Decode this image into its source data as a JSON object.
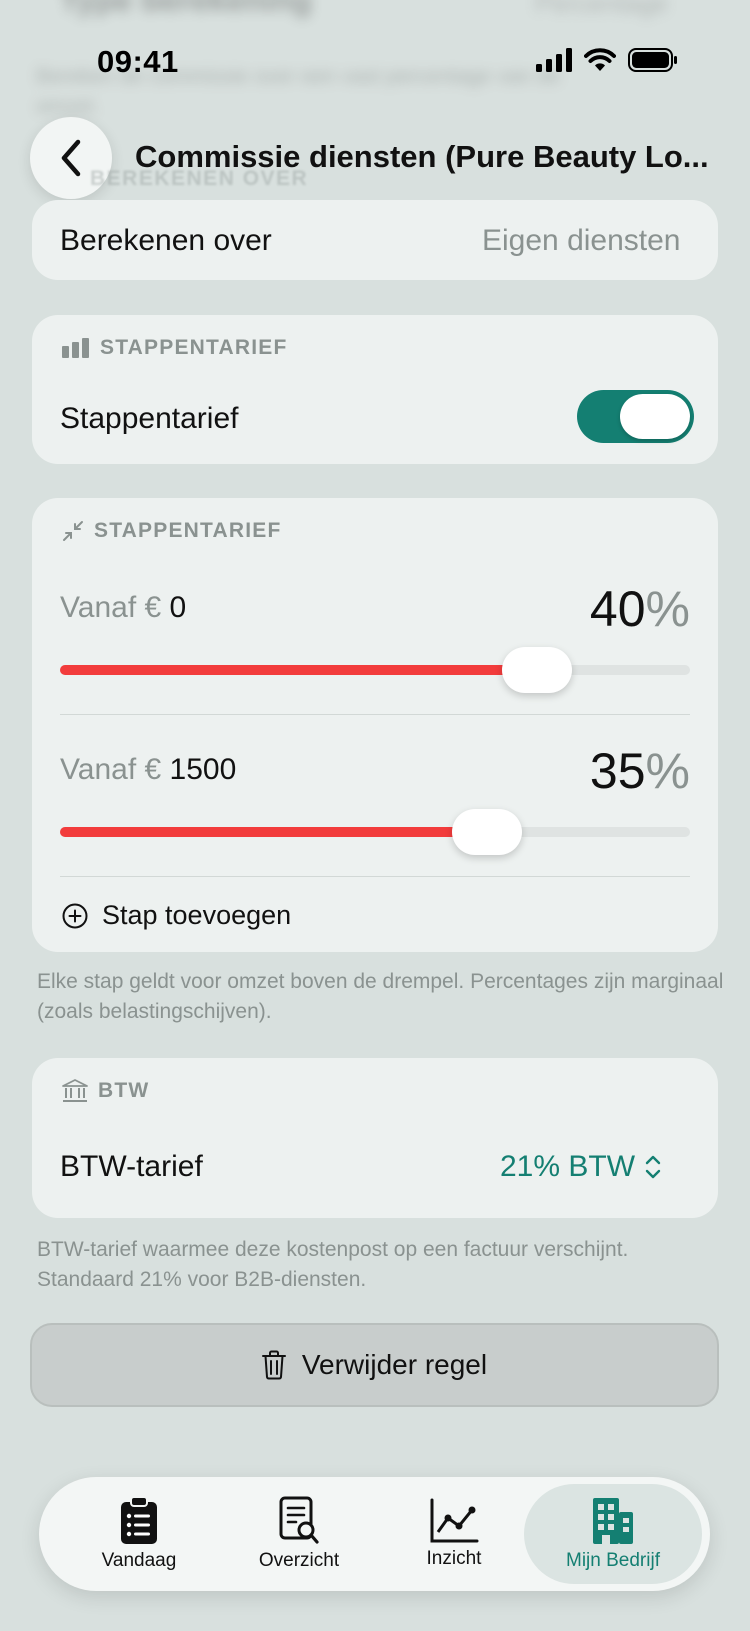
{
  "background": {
    "blurred_title": "Type berekening",
    "blurred_value": "Percentage",
    "blurred_text": "Bereken de commissie over een vast percentage van de omzet."
  },
  "status_bar": {
    "time": "09:41"
  },
  "header": {
    "back_icon": "chevron-left-icon",
    "title": "Commissie diensten (Pure Beauty Lo...",
    "ghost_section": "BEREKENEN OVER"
  },
  "berekenen": {
    "label": "Berekenen over",
    "value": "Eigen diensten"
  },
  "stappentarief_toggle": {
    "section_label": "STAPPENTARIEF",
    "section_icon": "bar-chart-icon",
    "label": "Stappentarief",
    "enabled": true
  },
  "stappen": {
    "section_label": "STAPPENTARIEF",
    "section_icon": "arrows-in-icon",
    "currency_prefix": "Vanaf €",
    "percent_symbol": "%",
    "steps": [
      {
        "threshold": "0",
        "percent": "40",
        "fraction": 0.79
      },
      {
        "threshold": "1500",
        "percent": "35",
        "fraction": 0.7
      }
    ],
    "add_label": "Stap toevoegen",
    "note": "Elke stap geldt voor omzet boven de drempel. Percentages zijn marginaal (zoals belastingschijven)."
  },
  "btw": {
    "section_label": "BTW",
    "section_icon": "bank-icon",
    "label": "BTW-tarief",
    "value": "21% BTW",
    "note": "BTW-tarief waarmee deze kostenpost op een factuur verschijnt. Standaard 21% voor B2B-diensten."
  },
  "delete": {
    "label": "Verwijder regel",
    "icon": "trash-icon"
  },
  "colors": {
    "accent": "#147f72",
    "slider_fill": "#f23c3c",
    "background": "#d8e0de"
  },
  "tabs": [
    {
      "label": "Vandaag",
      "icon": "clipboard-list-icon",
      "active": false
    },
    {
      "label": "Overzicht",
      "icon": "document-search-icon",
      "active": false
    },
    {
      "label": "Inzicht",
      "icon": "line-chart-icon",
      "active": false
    },
    {
      "label": "Mijn Bedrijf",
      "icon": "building-icon",
      "active": true
    }
  ]
}
